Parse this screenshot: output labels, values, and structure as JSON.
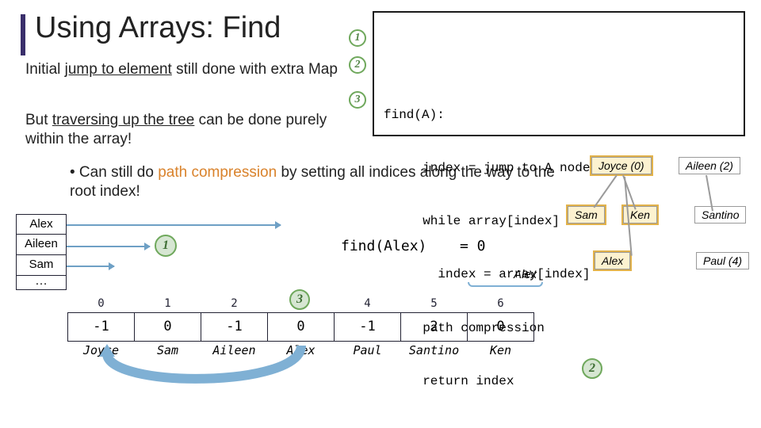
{
  "title": "Using Arrays: Find",
  "paragraphs": {
    "p1_a": "Initial ",
    "p1_b": "jump to element",
    "p1_c": " still done with extra Map",
    "p2_a": "But ",
    "p2_b": "traversing up the tree",
    "p2_c": " can be done purely within the array!",
    "p3_a": "• Can still do ",
    "p3_b": "path compression",
    "p3_c": " by setting all indices along the way to the root index!"
  },
  "code": {
    "l0": "find(A):",
    "l1": "  index = jump to A node's index",
    "l2": "  while array[index] > 0:",
    "l3": "    index = array[index]",
    "l4": "  path compression",
    "l5": "  return index"
  },
  "steps": {
    "s1": "1",
    "s2": "2",
    "s3": "3"
  },
  "map_items": [
    "Alex",
    "Aileen",
    "Sam",
    "…"
  ],
  "lookup_badge": "1",
  "find_call": "find(Alex)",
  "find_result": "= 0",
  "array": {
    "indices": [
      "0",
      "1",
      "2",
      "3",
      "4",
      "5",
      "6"
    ],
    "values": [
      "-1",
      "0",
      "-1",
      "0",
      "-1",
      "2",
      "0"
    ],
    "names": [
      "Joyce",
      "Sam",
      "Aileen",
      "Alex",
      "Paul",
      "Santino",
      "Ken"
    ]
  },
  "badge_three": "3",
  "badge_two": "2",
  "tree": {
    "root1": "Joyce (0)",
    "root2": "Aileen (2)",
    "sam": "Sam",
    "ken": "Ken",
    "alex": "Alex",
    "santino": "Santino",
    "paul": "Paul (4)"
  },
  "alex_ptr_label": "Alex"
}
